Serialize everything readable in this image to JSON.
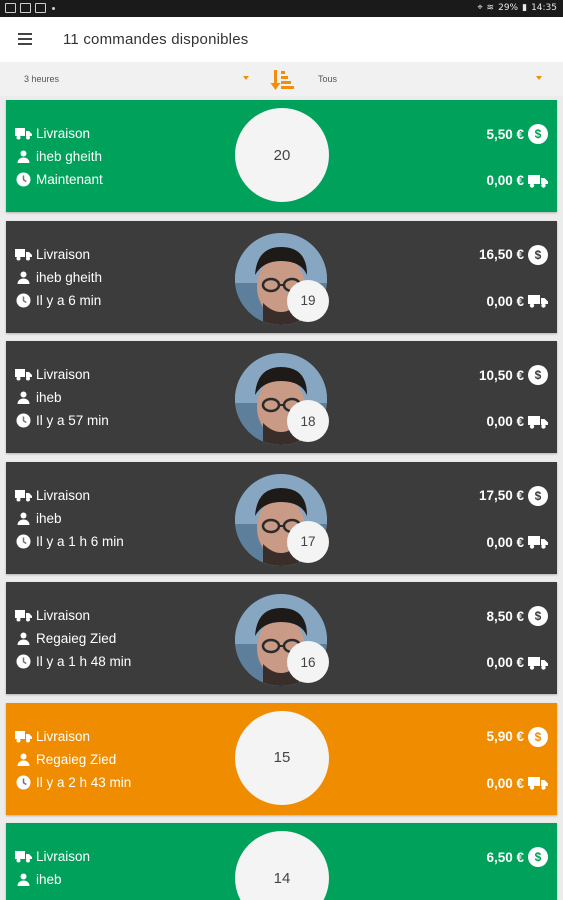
{
  "status_bar": {
    "battery": "29%",
    "time": "14:35"
  },
  "toolbar": {
    "title": "11 commandes disponibles"
  },
  "filters": {
    "time_window": "3 heures",
    "category": "Tous"
  },
  "colors": {
    "green": "#00a15a",
    "dark": "#3c3c3c",
    "orange": "#f08c00",
    "accent": "#f0900a"
  },
  "orders": [
    {
      "number": "20",
      "type": "Livraison",
      "customer": "iheb gheith",
      "time": "Maintenant",
      "price": "5,50 €",
      "fee": "0,00 €",
      "color": "green",
      "has_avatar": false
    },
    {
      "number": "19",
      "type": "Livraison",
      "customer": "iheb gheith",
      "time": "Il y a 6 min",
      "price": "16,50 €",
      "fee": "0,00 €",
      "color": "dark",
      "has_avatar": true
    },
    {
      "number": "18",
      "type": "Livraison",
      "customer": "iheb",
      "time": "Il y a 57 min",
      "price": "10,50 €",
      "fee": "0,00 €",
      "color": "dark",
      "has_avatar": true
    },
    {
      "number": "17",
      "type": "Livraison",
      "customer": "iheb",
      "time": "Il y a 1 h 6 min",
      "price": "17,50 €",
      "fee": "0,00 €",
      "color": "dark",
      "has_avatar": true
    },
    {
      "number": "16",
      "type": "Livraison",
      "customer": "Regaieg Zied",
      "time": "Il y a 1 h 48 min",
      "price": "8,50 €",
      "fee": "0,00 €",
      "color": "dark",
      "has_avatar": true
    },
    {
      "number": "15",
      "type": "Livraison",
      "customer": "Regaieg Zied",
      "time": "Il y a 2 h 43 min",
      "price": "5,90 €",
      "fee": "0,00 €",
      "color": "orange",
      "has_avatar": false
    },
    {
      "number": "14",
      "type": "Livraison",
      "customer": "iheb",
      "time": "",
      "price": "6,50 €",
      "fee": "",
      "color": "green",
      "has_avatar": false
    }
  ]
}
